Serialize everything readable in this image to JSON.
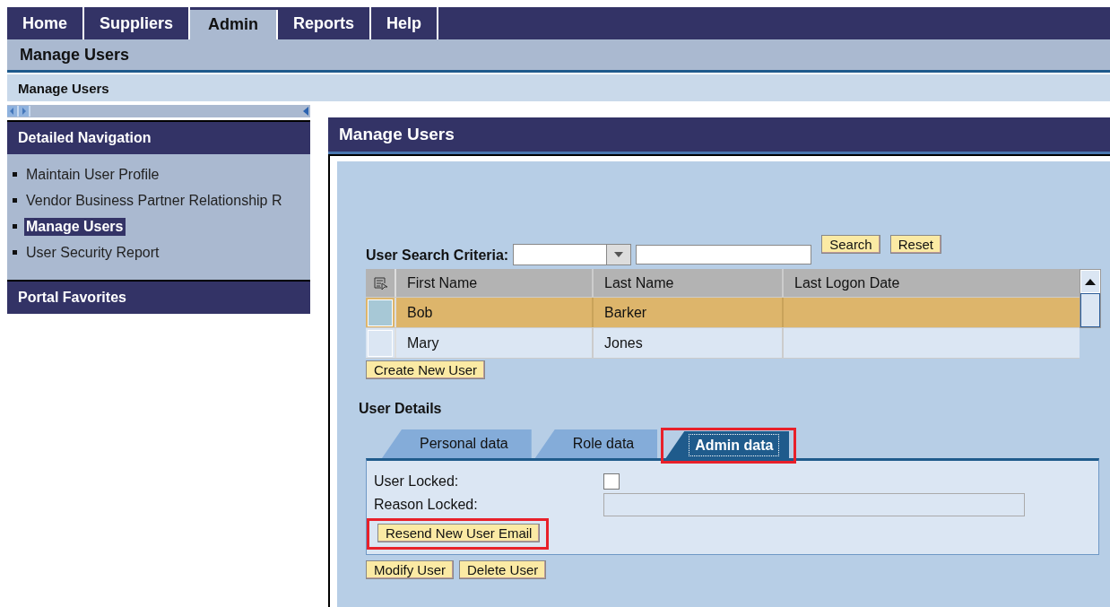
{
  "top_tabs": [
    {
      "label": "Home",
      "selected": false
    },
    {
      "label": "Suppliers",
      "selected": false
    },
    {
      "label": "Admin",
      "selected": true
    },
    {
      "label": "Reports",
      "selected": false
    },
    {
      "label": "Help",
      "selected": false
    }
  ],
  "sub_bar": "Manage Users",
  "breadcrumb": "Manage Users",
  "navigation": {
    "title": "Detailed Navigation",
    "items": [
      {
        "label": "Maintain User Profile",
        "selected": false
      },
      {
        "label": "Vendor Business Partner Relationship R",
        "selected": false
      },
      {
        "label": "Manage Users",
        "selected": true
      },
      {
        "label": "User Security Report",
        "selected": false
      }
    ]
  },
  "favorites": {
    "title": "Portal Favorites"
  },
  "panel": {
    "title": "Manage Users",
    "search": {
      "label": "User Search Criteria:",
      "buttons": [
        "Search",
        "Reset"
      ]
    },
    "table": {
      "columns": [
        "First Name",
        "Last Name",
        "Last Logon Date"
      ],
      "rows": [
        {
          "cells": [
            "Bob",
            "Barker",
            ""
          ],
          "selected": true
        },
        {
          "cells": [
            "Mary",
            "Jones",
            ""
          ],
          "selected": false
        }
      ]
    },
    "create_button": "Create New User",
    "details_title": "User Details",
    "detail_tabs": [
      {
        "label": "Personal data",
        "selected": false,
        "highlighted": false
      },
      {
        "label": "Role data",
        "selected": false,
        "highlighted": false
      },
      {
        "label": "Admin data",
        "selected": true,
        "highlighted": true
      }
    ],
    "user_locked": {
      "label": "User Locked:",
      "checked": false
    },
    "reason_locked": {
      "label": "Reason Locked:"
    },
    "resend_button": {
      "label": "Resend New User Email",
      "highlighted": true
    },
    "buttons": [
      "Modify User",
      "Delete User"
    ]
  }
}
